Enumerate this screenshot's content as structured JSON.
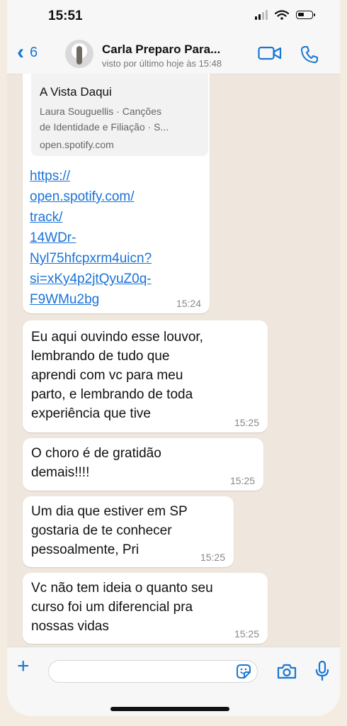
{
  "status_bar": {
    "time": "15:51"
  },
  "header": {
    "back_count": "6",
    "contact_name": "Carla Preparo Para...",
    "contact_status": "visto por último hoje às 15:48"
  },
  "messages": [
    {
      "link_preview": {
        "title": "A Vista Daqui",
        "description": "Laura Souguellis · Canções\nde Identidade e Filiação · S...",
        "domain": "open.spotify.com"
      },
      "link": "https://\nopen.spotify.com/\ntrack/\n14WDr-\nNyl75hfcpxrm4uicn?\nsi=xKy4p2jtQyuZ0q-\nF9WMu2bg",
      "time": "15:24"
    },
    {
      "text": "Eu aqui ouvindo esse louvor,\nlembrando de tudo que\naprendi com vc para meu\nparto, e lembrando de toda\nexperiência que tive",
      "time": "15:25"
    },
    {
      "text": "O choro é de gratidão\ndemais!!!!",
      "time": "15:25"
    },
    {
      "text": "Um dia que estiver em SP\ngostaria de te conhecer\npessoalmente, Pri",
      "time": "15:25"
    },
    {
      "text": "Vc não tem ideia o quanto seu\ncurso foi um diferencial pra\nnossas vidas",
      "time": "15:25"
    }
  ],
  "input": {
    "value": ""
  },
  "icons": {
    "back": "chevron-left-icon",
    "video_call": "video-camera-icon",
    "voice_call": "phone-icon",
    "attach": "plus-icon",
    "sticker": "sticker-icon",
    "camera": "camera-icon",
    "microphone": "microphone-icon"
  },
  "colors": {
    "accent": "#1877d4",
    "link": "#1a73d9",
    "chat_bg": "#efe7dd",
    "bubble": "#ffffff"
  }
}
